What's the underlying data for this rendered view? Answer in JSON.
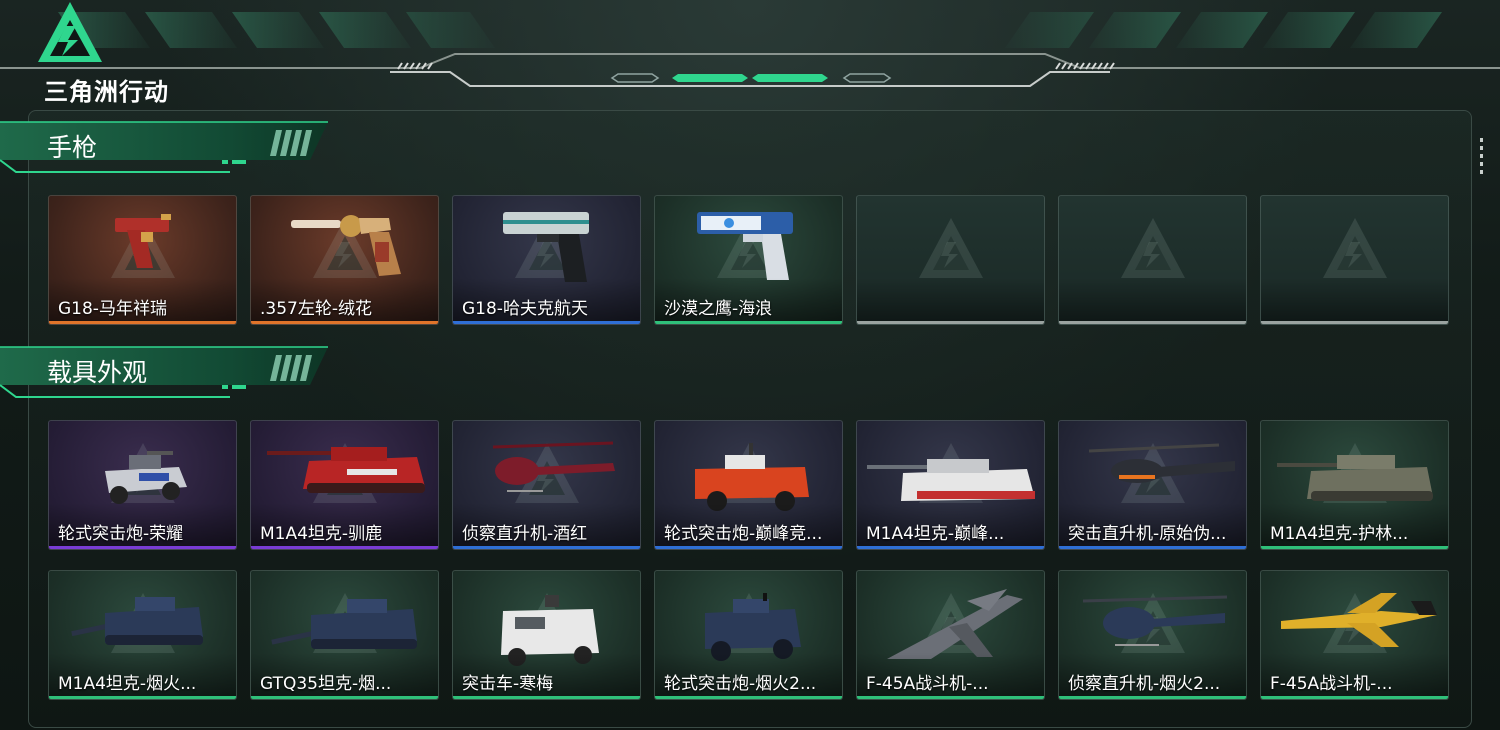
{
  "brand": {
    "logo_text": "三角洲行动"
  },
  "colors": {
    "accent": "#2fd68e",
    "rarity_orange": "#e0742a",
    "rarity_blue": "#2f6fd6",
    "rarity_green": "#2fc07a",
    "rarity_purple": "#7a3cd6",
    "rarity_empty": "#9aa3a0"
  },
  "sections": [
    {
      "title": "手枪",
      "items": [
        {
          "label": "G18-马年祥瑞",
          "rarity": "orange",
          "icon": "pistol-red-gold-icon"
        },
        {
          "label": ".357左轮-绒花",
          "rarity": "orange",
          "icon": "revolver-gold-icon"
        },
        {
          "label": "G18-哈夫克航天",
          "rarity": "blue",
          "icon": "pistol-black-teal-icon"
        },
        {
          "label": "沙漠之鹰-海浪",
          "rarity": "green",
          "icon": "desert-eagle-blue-icon"
        },
        {
          "label": "",
          "rarity": "empty",
          "icon": "empty-slot-icon"
        },
        {
          "label": "",
          "rarity": "empty",
          "icon": "empty-slot-icon"
        },
        {
          "label": "",
          "rarity": "empty",
          "icon": "empty-slot-icon"
        }
      ]
    },
    {
      "title": "载具外观",
      "items": [
        {
          "label": "轮式突击炮-荣耀",
          "rarity": "purple",
          "icon": "armored-car-icon"
        },
        {
          "label": "M1A4坦克-驯鹿",
          "rarity": "purple",
          "icon": "tank-red-icon"
        },
        {
          "label": "侦察直升机-酒红",
          "rarity": "blue",
          "icon": "scout-helicopter-icon"
        },
        {
          "label": "轮式突击炮-巅峰竞...",
          "rarity": "blue",
          "icon": "armored-car-red-icon"
        },
        {
          "label": "M1A4坦克-巅峰...",
          "rarity": "blue",
          "icon": "tank-racing-icon"
        },
        {
          "label": "突击直升机-原始伪...",
          "rarity": "blue",
          "icon": "attack-helicopter-icon"
        },
        {
          "label": "M1A4坦克-护林...",
          "rarity": "green",
          "icon": "tank-camo-icon"
        },
        {
          "label": "M1A4坦克-烟火...",
          "rarity": "green",
          "icon": "tank-navy-icon"
        },
        {
          "label": "GTQ35坦克-烟...",
          "rarity": "green",
          "icon": "light-tank-navy-icon"
        },
        {
          "label": "突击车-寒梅",
          "rarity": "green",
          "icon": "assault-vehicle-white-icon"
        },
        {
          "label": "轮式突击炮-烟火2...",
          "rarity": "green",
          "icon": "armored-car-navy-icon"
        },
        {
          "label": "F-45A战斗机-...",
          "rarity": "green",
          "icon": "fighter-jet-camo-icon"
        },
        {
          "label": "侦察直升机-烟火2...",
          "rarity": "green",
          "icon": "scout-helicopter-navy-icon"
        },
        {
          "label": "F-45A战斗机-...",
          "rarity": "green",
          "icon": "fighter-jet-yellow-icon"
        }
      ]
    }
  ]
}
